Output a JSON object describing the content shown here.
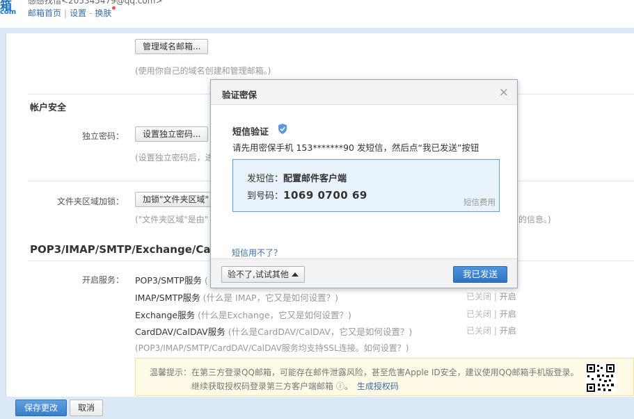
{
  "header": {
    "logo_text": "箱",
    "logo_sub": "com",
    "user_text": "感感找惜<205345479@qq.com>",
    "links": [
      "邮箱首页",
      "设置",
      "换肤"
    ]
  },
  "domain_section": {
    "manage_button": "管理域名邮箱...",
    "hint": "(使用你自己的域名创建和管理邮箱。)"
  },
  "security": {
    "title": "帐户安全",
    "independent_label": "独立密码：",
    "independent_button": "设置独立密码...",
    "independent_hint": "(设置独立密码后，进",
    "folder_lock_label": "文件夹区域加锁：",
    "folder_lock_button": "加锁\"文件夹区域\"",
    "folder_lock_hint": "(\"文件夹区域\"是由\"",
    "folder_lock_hint_end": "的信息。)"
  },
  "pop": {
    "title": "POP3/IMAP/SMTP/Exchange/Ca",
    "enable_label": "开启服务：",
    "services": [
      {
        "name": "POP3/SMTP服务",
        "q": "(",
        "closed": "",
        "open": ""
      },
      {
        "name": "IMAP/SMTP服务",
        "q": "(什么是 IMAP，它又是如何设置？)",
        "closed": "已关闭",
        "open": "开启"
      },
      {
        "name": "Exchange服务",
        "q": "(什么是Exchange，它又是如何设置？)",
        "closed": "已关闭",
        "open": "开启"
      },
      {
        "name": "CardDAV/CalDAV服务",
        "q": "(什么是CardDAV/CalDAV，它又是如何设置？)",
        "closed": "已关闭",
        "open": "开启"
      }
    ],
    "ssl_note": "(POP3/IMAP/SMTP/CardDAV/CalDAV服务均支持SSL连接。如何设置？)",
    "tip_line1": "温馨提示：在第三方登录QQ邮箱，可能存在邮件泄露风险，甚至危害Apple ID安全，建议使用QQ邮箱手机版登录。",
    "tip_line2": "继续获取授权码登录第三方客户端邮箱 ⓘ。",
    "tip_link": "生成授权码"
  },
  "footer": {
    "save": "保存更改",
    "cancel": "取消"
  },
  "modal": {
    "title": "验证密保",
    "close": "×",
    "sms_title": "短信验证",
    "desc": "请先用密保手机 153*******90 发短信，然后点“我已发送”按钮",
    "send_label": "发短信：",
    "send_value": "配置邮件客户端",
    "to_label": "到号码：",
    "to_value": "1069 0700 69",
    "fee": "短信费用",
    "fail_link": "短信用不了？",
    "other_button": "验不了,试试其他",
    "sent_button": "我已发送"
  },
  "colors": {
    "accent": "#2f74c2",
    "frame": "#dbe8f6",
    "info_bg": "#e9f3fc"
  }
}
